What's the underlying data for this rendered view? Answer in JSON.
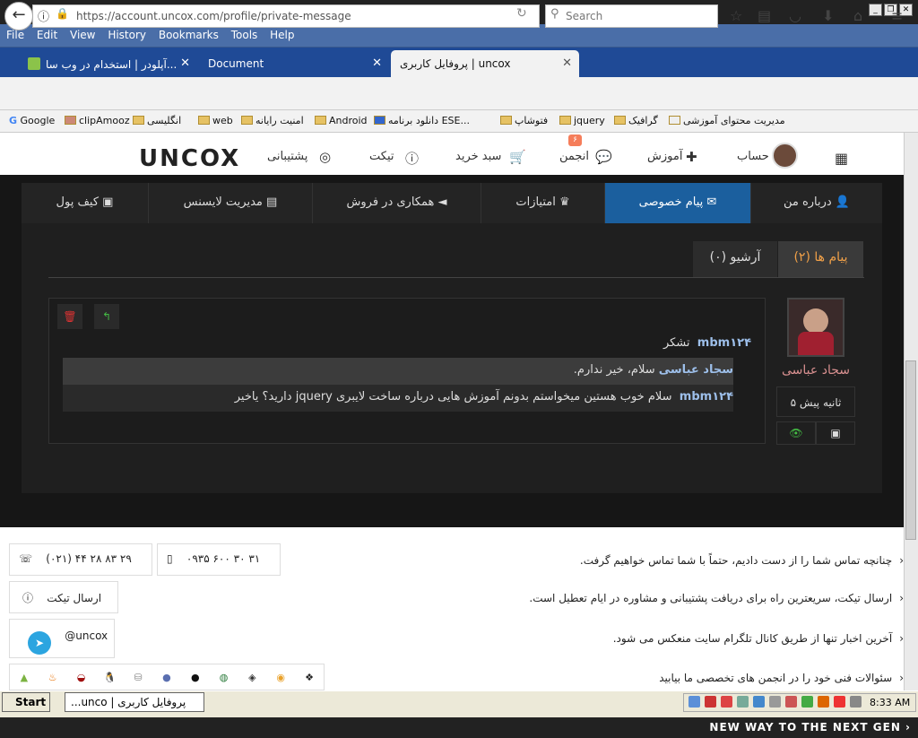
{
  "brand": {
    "top_logo": "uncox",
    "slogan": "NEW WAY TO THE NEXT GEN ›"
  },
  "menu": [
    "File",
    "Edit",
    "View",
    "History",
    "Bookmarks",
    "Tools",
    "Help"
  ],
  "tabs": [
    {
      "label": "آپلودر | استخدام در وب سا...",
      "active": false
    },
    {
      "label": "Document",
      "active": false
    },
    {
      "label": "پروفایل کاربری | uncox",
      "active": true
    }
  ],
  "url": "https://account.uncox.com/profile/private-message",
  "search_placeholder": "Search",
  "bookmarks": [
    "Google",
    "clipAmooz",
    "انگلیسی",
    "web",
    "امنیت رایانه",
    "Android",
    "دانلود برنامه ESE...",
    "فتوشاپ",
    "jquery",
    "گرافیک",
    "مدیریت محتوای آموزشی"
  ],
  "site": {
    "logo": "UNCOX",
    "nav": {
      "support": "پشتیبانی",
      "ticket": "تیکت",
      "cart": "سبد خرید",
      "forum": "انجمن",
      "forum_badge": "۶",
      "learn": "آموزش",
      "account": "حساب"
    }
  },
  "profile_nav": [
    {
      "label": "کیف پول",
      "icon": "wallet-icon"
    },
    {
      "label": "مدیریت لایسنس",
      "icon": "license-icon"
    },
    {
      "label": "همکاری در فروش",
      "icon": "megaphone-icon"
    },
    {
      "label": "امتیازات",
      "icon": "trophy-icon"
    },
    {
      "label": "پیام خصوصی",
      "icon": "envelope-icon",
      "active": true
    },
    {
      "label": "درباره من",
      "icon": "user-icon"
    }
  ],
  "message_tabs": {
    "messages": "پیام ها (۲)",
    "archive": "آرشیو (۰)"
  },
  "message": {
    "reply_user": "mbm۱۲۴",
    "reply_text": "تشکر",
    "rows": [
      {
        "user": "سجاد عباسی",
        "text": "سلام، خیر ندارم."
      },
      {
        "user": "mbm۱۲۴",
        "text": "سلام خوب هستین میخواستم بدونم آموزش هایی درباره ساخت لایبری jquery دارید؟ یاخیر"
      }
    ],
    "sender_name": "سجاد عباسی",
    "time": "۵ ثانیه پیش"
  },
  "footer": {
    "phone1": "(۰۲۱) ۴۴ ۲۸ ۸۳ ۲۹",
    "phone2": "۰۹۳۵ ۶۰۰ ۳۰ ۳۱",
    "ticket_btn": "ارسال تیکت",
    "telegram": "@uncox",
    "q1": "چنانچه تماس شما را از دست دادیم، حتماً با شما تماس خواهیم گرفت.",
    "q2": "ارسال تیکت، سریعترین راه برای دریافت پشتیبانی و مشاوره در ایام تعطیل است.",
    "q3": "آخرین اخبار تنها از طریق کانال تلگرام سایت منعکس می شود.",
    "q4": "سئوالات فنی خود را در انجمن های تخصصی ما بیابید"
  },
  "taskbar": {
    "start": "Start",
    "item": "پروفایل کاربری | unco...",
    "clock": "8:33 AM"
  }
}
